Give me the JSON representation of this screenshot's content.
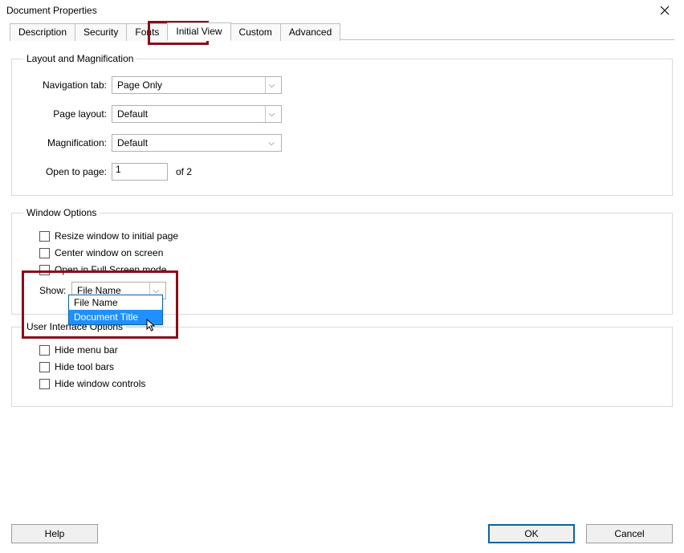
{
  "window": {
    "title": "Document Properties"
  },
  "tabs": {
    "items": [
      "Description",
      "Security",
      "Fonts",
      "Initial View",
      "Custom",
      "Advanced"
    ],
    "active_index": 3
  },
  "layout_group": {
    "legend": "Layout and Magnification",
    "nav_label": "Navigation tab:",
    "nav_value": "Page Only",
    "pagelayout_label": "Page layout:",
    "pagelayout_value": "Default",
    "mag_label": "Magnification:",
    "mag_value": "Default",
    "open_label": "Open to page:",
    "open_value": "1",
    "open_suffix": "of 2"
  },
  "window_group": {
    "legend": "Window Options",
    "resize": "Resize window to initial page",
    "center": "Center window on screen",
    "fullscreen": "Open in Full Screen mode",
    "show_label": "Show:",
    "show_value": "File Name",
    "show_options": [
      "File Name",
      "Document Title"
    ],
    "show_highlight_index": 1
  },
  "ui_group": {
    "legend": "User Interface Options",
    "hidemenu": "Hide menu bar",
    "hidetool": "Hide tool bars",
    "hidewin": "Hide window controls"
  },
  "buttons": {
    "help": "Help",
    "ok": "OK",
    "cancel": "Cancel"
  }
}
